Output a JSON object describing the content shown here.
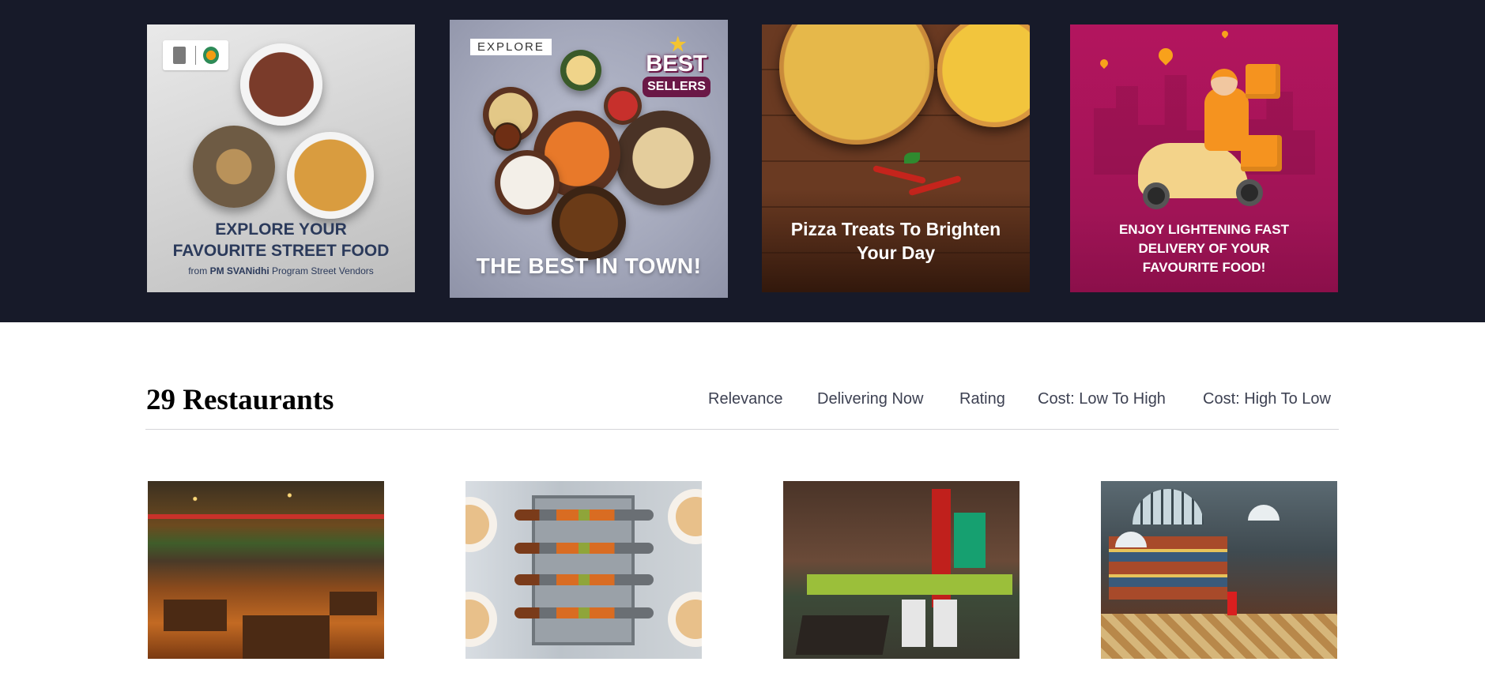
{
  "banners": [
    {
      "id": "street-food",
      "caption_line1": "EXPLORE YOUR",
      "caption_line2": "FAVOURITE STREET FOOD",
      "sub_prefix": "from",
      "sub_bold": "PM SVANidhi",
      "sub_suffix": "Program Street Vendors"
    },
    {
      "id": "best-sellers",
      "tag": "EXPLORE",
      "badge_top": "BEST",
      "badge_bottom": "SELLERS",
      "caption": "THE BEST IN TOWN!"
    },
    {
      "id": "pizza",
      "caption_line1": "Pizza Treats To Brighten",
      "caption_line2": "Your Day"
    },
    {
      "id": "delivery",
      "caption_line1": "ENJOY LIGHTENING FAST",
      "caption_line2": "DELIVERY OF YOUR",
      "caption_line3": "FAVOURITE FOOD!"
    }
  ],
  "restaurants_header": {
    "title": "29 Restaurants",
    "sort_options": [
      "Relevance",
      "Delivering Now",
      "Rating",
      "Cost: Low To High",
      "Cost: High To Low"
    ]
  },
  "restaurant_cards": [
    {
      "image": "restaurant-interior-lights-photo"
    },
    {
      "image": "barbecue-grill-skewers-photo"
    },
    {
      "image": "restaurant-interior-red-wall-photo"
    },
    {
      "image": "open-kitchen-counter-photo"
    }
  ],
  "colors": {
    "banner_background": "#171a29",
    "sort_text": "#3d4152",
    "divider": "#d4d5d9",
    "delivery_banner": "#a01456",
    "best_sellers_badge": "#6a1846"
  }
}
